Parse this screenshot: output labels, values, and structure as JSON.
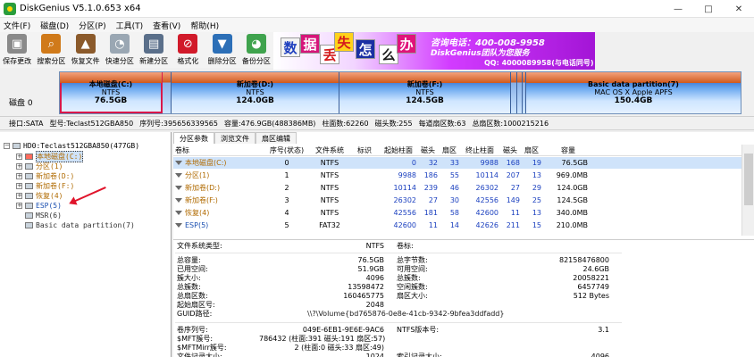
{
  "window": {
    "title": "DiskGenius V5.1.0.653 x64",
    "minimize": "—",
    "maximize": "□",
    "close": "✕"
  },
  "menu": [
    "文件(F)",
    "磁盘(D)",
    "分区(P)",
    "工具(T)",
    "查看(V)",
    "帮助(H)"
  ],
  "toolbar": [
    {
      "label": "保存更改",
      "icon": "save-icon",
      "color": "#8a8a8a",
      "glyph": "▣"
    },
    {
      "label": "搜索分区",
      "icon": "search-icon",
      "color": "#d07a1a",
      "glyph": "⌕"
    },
    {
      "label": "恢复文件",
      "icon": "recover-icon",
      "color": "#8b5a2b",
      "glyph": "▲"
    },
    {
      "label": "快速分区",
      "icon": "quick-partition-icon",
      "color": "#9aa7b3",
      "glyph": "◔"
    },
    {
      "label": "新建分区",
      "icon": "new-partition-icon",
      "color": "#5a6f8a",
      "glyph": "▤"
    },
    {
      "label": "格式化",
      "icon": "format-icon",
      "color": "#d11a2a",
      "glyph": "⊘"
    },
    {
      "label": "删除分区",
      "icon": "delete-partition-icon",
      "color": "#2c6fb7",
      "glyph": "▼"
    },
    {
      "label": "备份分区",
      "icon": "backup-partition-icon",
      "color": "#3fa34d",
      "glyph": "◕"
    }
  ],
  "banner": {
    "chars": [
      "数",
      "据",
      "丢",
      "失",
      "怎",
      "么",
      "办"
    ],
    "phone": "咨询电话：400-008-9958",
    "brand": "DiskGenius团队为您服务",
    "qq": "QQ: 4000089958(与电话同号)"
  },
  "disk_bar": {
    "label": "磁盘 0",
    "partitions": [
      {
        "name": "本地磁盘(C:)",
        "fs": "NTFS",
        "size": "76.5GB",
        "selected": true
      },
      {
        "name": "新加卷(D:)",
        "fs": "NTFS",
        "size": "124.0GB",
        "selected": false
      },
      {
        "name": "新加卷(F:)",
        "fs": "NTFS",
        "size": "124.5GB",
        "selected": false
      },
      {
        "name": "Basic data partition(7)",
        "fs": "MAC OS X Apple APFS",
        "size": "150.4GB",
        "selected": false
      }
    ]
  },
  "disk_info": [
    "接口:SATA",
    "型号:Teclast512GBA850",
    "序列号:395656339565",
    "容量:476.9GB(488386MB)",
    "柱面数:62260",
    "磁头数:255",
    "每道扇区数:63",
    "总扇区数:1000215216"
  ],
  "tree": {
    "root": "HD0:Teclast512GBA850(477GB)",
    "items": [
      {
        "label": "本地磁盘(C:)",
        "color": "#b06a00",
        "selected": true,
        "icon": "red"
      },
      {
        "label": "分区(1)",
        "color": "#b06a00",
        "selected": false,
        "icon": "gray"
      },
      {
        "label": "新加卷(D:)",
        "color": "#b06a00",
        "selected": false,
        "icon": "gray"
      },
      {
        "label": "新加卷(F:)",
        "color": "#b06a00",
        "selected": false,
        "icon": "gray"
      },
      {
        "label": "恢复(4)",
        "color": "#b06a00",
        "selected": false,
        "icon": "gray"
      },
      {
        "label": "ESP(5)",
        "color": "#1a4fb0",
        "selected": false,
        "icon": "gray"
      },
      {
        "label": "MSR(6)",
        "color": "#333333",
        "selected": false,
        "icon": "gray"
      },
      {
        "label": "Basic data partition(7)",
        "color": "#333333",
        "selected": false,
        "icon": "gray"
      }
    ]
  },
  "tabs": [
    "分区参数",
    "浏览文件",
    "扇区编辑"
  ],
  "partition_table": {
    "headers": [
      "卷标",
      "序号(状态)",
      "文件系统",
      "标识",
      "起始柱面",
      "磁头",
      "扇区",
      "终止柱面",
      "磁头",
      "扇区",
      "容量"
    ],
    "rows": [
      [
        "本地磁盘(C:)",
        "0",
        "NTFS",
        "",
        "0",
        "32",
        "33",
        "9988",
        "168",
        "19",
        "76.5GB"
      ],
      [
        "分区(1)",
        "1",
        "NTFS",
        "",
        "9988",
        "186",
        "55",
        "10114",
        "207",
        "13",
        "969.0MB"
      ],
      [
        "新加卷(D:)",
        "2",
        "NTFS",
        "",
        "10114",
        "239",
        "46",
        "26302",
        "27",
        "29",
        "124.0GB"
      ],
      [
        "新加卷(F:)",
        "3",
        "NTFS",
        "",
        "26302",
        "27",
        "30",
        "42556",
        "149",
        "25",
        "124.5GB"
      ],
      [
        "恢复(4)",
        "4",
        "NTFS",
        "",
        "42556",
        "181",
        "58",
        "42600",
        "11",
        "13",
        "340.0MB"
      ],
      [
        "ESP(5)",
        "5",
        "FAT32",
        "",
        "42600",
        "11",
        "14",
        "42626",
        "211",
        "15",
        "210.0MB"
      ]
    ]
  },
  "details": {
    "fs_type_label": "文件系统类型:",
    "fs_type": "NTFS",
    "volume_label": "卷标:",
    "left": [
      [
        "总容量:",
        "76.5GB"
      ],
      [
        "已用空间:",
        "51.9GB"
      ],
      [
        "簇大小:",
        "4096"
      ],
      [
        "总簇数:",
        "13598472"
      ],
      [
        "总扇区数:",
        "160465775"
      ],
      [
        "起始扇区号:",
        "2048"
      ]
    ],
    "right": [
      [
        "总字节数:",
        "82158476800"
      ],
      [
        "可用空间:",
        "24.6GB"
      ],
      [
        "总簇数:",
        "20058221"
      ],
      [
        "空闲簇数:",
        "6457749"
      ],
      [
        "扇区大小:",
        "512 Bytes"
      ]
    ],
    "guid_label": "GUID路径:",
    "guid": "\\\\?\\Volume{bd765876-0e8e-41cb-9342-9bfea3ddfadd}",
    "bottom_left": [
      [
        "卷序列号:",
        "049E-6EB1-9E6E-9AC6"
      ],
      [
        "$MFT簇号:",
        "786432 (柱面:391 磁头:191 扇区:57)"
      ],
      [
        "$MFTMirr簇号:",
        "2 (柱面:0 磁头:33 扇区:49)"
      ],
      [
        "文件记录大小:",
        "1024"
      ]
    ],
    "bottom_right": [
      [
        "NTFS版本号:",
        "3.1"
      ],
      [
        "",
        ""
      ],
      [
        "",
        ""
      ],
      [
        "索引记录大小:",
        "4096"
      ]
    ]
  }
}
